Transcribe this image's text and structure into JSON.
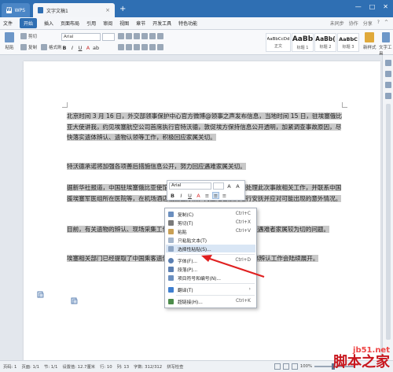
{
  "titlebar": {
    "app_tab": "WPS",
    "doc_tab": "文字文稿1",
    "add_tab": "+",
    "close": "×",
    "window_buttons": [
      "—",
      "□",
      "✕"
    ]
  },
  "menubar": {
    "file": "文件",
    "items": [
      "开始",
      "插入",
      "页面布局",
      "引用",
      "审阅",
      "视图",
      "章节",
      "开发工具",
      "特色功能"
    ],
    "right_items": [
      "未同步",
      "协作",
      "分享",
      "?",
      "^"
    ]
  },
  "ribbon": {
    "paste": "粘贴",
    "cut": "剪切",
    "copy": "复制",
    "format_painter": "格式刷",
    "font_name": "Arial",
    "font_size": "",
    "bold": "B",
    "italic": "I",
    "underline": "U",
    "styles": [
      {
        "sample": "AaBbCcDd",
        "name": "正文"
      },
      {
        "sample": "AaBb",
        "name": "标题 1"
      },
      {
        "sample": "AaBb(",
        "name": "标题 2"
      },
      {
        "sample": "AaBbC",
        "name": "标题 3"
      }
    ],
    "new_style": "新样式",
    "text_tool": "文字工具"
  },
  "document": {
    "paragraphs": [
      "北京时间 3 月 16 日，外交部领事保护中心官方微博@领事之声发布信息，当地时间 15 日，驻埃塞俄比亚大使讲我，约见埃塞航空公司首席执行官特沃德，敦促埃方保持信息公开透明，加紧调查事故原因，尽快落实遗体辨认、遗物认领等工作，积极回应家属关切。",
      "特沃德承诺将加强各项善后措施信息公开，努力回应遇难家属关切。",
      "据新华社报道，中国驻埃塞俄比亚使馆领事保护小组连日来全力协调处理此次事故相关工作，并联系中国援埃塞军医组所在医院等，在机场酒店设置医疗点，对遇难者家属进行安抚并应对可能出现的意外情况。",
      "目前，有关遗物的辨认、现场采集工作已经开始，家属普遍关心的问题是遇难者家属较为切的问题。",
      "埃塞相关部门已经提取了中国乘客遗体DNA样本，并表示将尽快完成遗体辨认工作会陆续展开。"
    ]
  },
  "mini_toolbar": {
    "font": "Arial",
    "size": "",
    "buttons": [
      "B",
      "I",
      "U",
      "A",
      "≡",
      "≡",
      "≡"
    ]
  },
  "context_menu": {
    "items": [
      {
        "label": "复制(C)",
        "shortcut": "Ctrl+C"
      },
      {
        "label": "剪切(T)",
        "shortcut": "Ctrl+X"
      },
      {
        "label": "粘贴",
        "shortcut": "Ctrl+V"
      },
      {
        "label": "只粘贴文本(T)",
        "shortcut": ""
      },
      {
        "label": "选择性粘贴(S)...",
        "shortcut": ""
      },
      {
        "label": "字体(F)...",
        "shortcut": "Ctrl+D"
      },
      {
        "label": "段落(P)...",
        "shortcut": ""
      },
      {
        "label": "项目符号和编号(N)...",
        "shortcut": ""
      },
      {
        "label": "翻译(T)",
        "shortcut": ""
      },
      {
        "label": "超链接(H)...",
        "shortcut": "Ctrl+K"
      }
    ],
    "highlighted_index": 4
  },
  "statusbar": {
    "page": "页码: 1",
    "pages": "页面: 1/1",
    "section": "节: 1/1",
    "position": "设置值: 12.7厘米",
    "row": "行: 10",
    "column": "列: 13",
    "word_count": "字数: 312/312",
    "spell": "拼写检查",
    "zoom": "100%"
  },
  "watermark": {
    "url": "jb51.net",
    "name": "脚本之家"
  },
  "colors": {
    "titlebar": "#2f6fb3",
    "selection": "#c8c8c8",
    "menu_hover": "#d9e6f5",
    "arrow": "#e02020",
    "watermark": "#c8161d"
  }
}
